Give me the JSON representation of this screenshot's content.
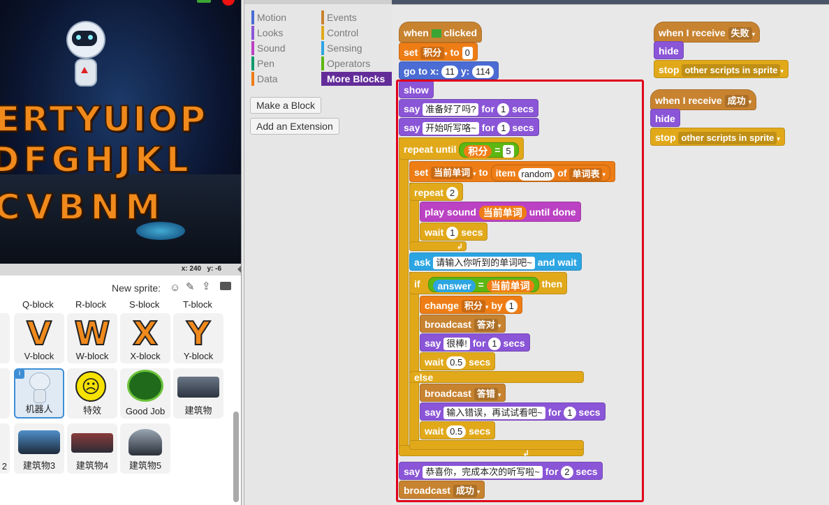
{
  "stage": {
    "keyboard_rows": [
      "ERTYUIOP",
      "DFGHJKL",
      "CVBNM"
    ],
    "coords_x": "x: 240",
    "coords_y": "y: -6"
  },
  "sprites": {
    "new_sprite_label": "New sprite:",
    "top_row": [
      "Q-block",
      "R-block",
      "S-block",
      "T-block"
    ],
    "row1": [
      {
        "label": "V-block",
        "glyph": "V"
      },
      {
        "label": "W-block",
        "glyph": "W"
      },
      {
        "label": "X-block",
        "glyph": "X"
      },
      {
        "label": "Y-block",
        "glyph": "Y"
      }
    ],
    "row2": [
      "机器人",
      "特效",
      "Good Job",
      "建筑物"
    ],
    "row3": [
      "建筑物3",
      "建筑物4",
      "建筑物5"
    ],
    "edge_letters": [
      "k",
      "k",
      "2"
    ]
  },
  "palette": {
    "categories": [
      {
        "label": "Motion",
        "color": "#4a6cd4"
      },
      {
        "label": "Events",
        "color": "#c88330"
      },
      {
        "label": "Looks",
        "color": "#8a55d7"
      },
      {
        "label": "Control",
        "color": "#e1a91a"
      },
      {
        "label": "Sound",
        "color": "#bb42c3"
      },
      {
        "label": "Sensing",
        "color": "#2ca5e2"
      },
      {
        "label": "Pen",
        "color": "#0e9a6c"
      },
      {
        "label": "Operators",
        "color": "#5cb712"
      },
      {
        "label": "Data",
        "color": "#ee7d16"
      },
      {
        "label": "More Blocks",
        "color": "#632d99"
      }
    ],
    "make_block": "Make a Block",
    "add_extension": "Add an Extension"
  },
  "script": {
    "when": "when",
    "clicked": "clicked",
    "set": "set",
    "var_score": "积分",
    "to": "to",
    "zero": "0",
    "goto": "go to x:",
    "x_val": "11",
    "y_lbl": "y:",
    "y_val": "114",
    "show": "show",
    "say": "say",
    "say1": "准备好了吗?",
    "for": "for",
    "one": "1",
    "secs": "secs",
    "say2": "开始听写咯~",
    "repeat_until": "repeat until",
    "five": "5",
    "eq": "=",
    "var_word": "当前单词",
    "item": "item",
    "random": "random",
    "of": "of",
    "list": "单词表",
    "repeat": "repeat",
    "two": "2",
    "play_sound": "play sound",
    "until_done": "until done",
    "wait": "wait",
    "ask": "ask",
    "ask_text": "请输入你听到的单词吧~",
    "and_wait": "and wait",
    "if": "if",
    "answer": "answer",
    "then": "then",
    "change": "change",
    "by": "by",
    "broadcast": "broadcast",
    "msg_right": "答对",
    "say3": "很棒!",
    "half": "0.5",
    "else": "else",
    "msg_wrong": "答错",
    "say4": "输入错误，再试试看吧~",
    "say5": "恭喜你，完成本次的听写啦~",
    "msg_success": "成功",
    "when_receive": "when I receive",
    "msg_fail": "失败",
    "hide": "hide",
    "stop": "stop",
    "other_scripts": "other scripts in sprite"
  }
}
